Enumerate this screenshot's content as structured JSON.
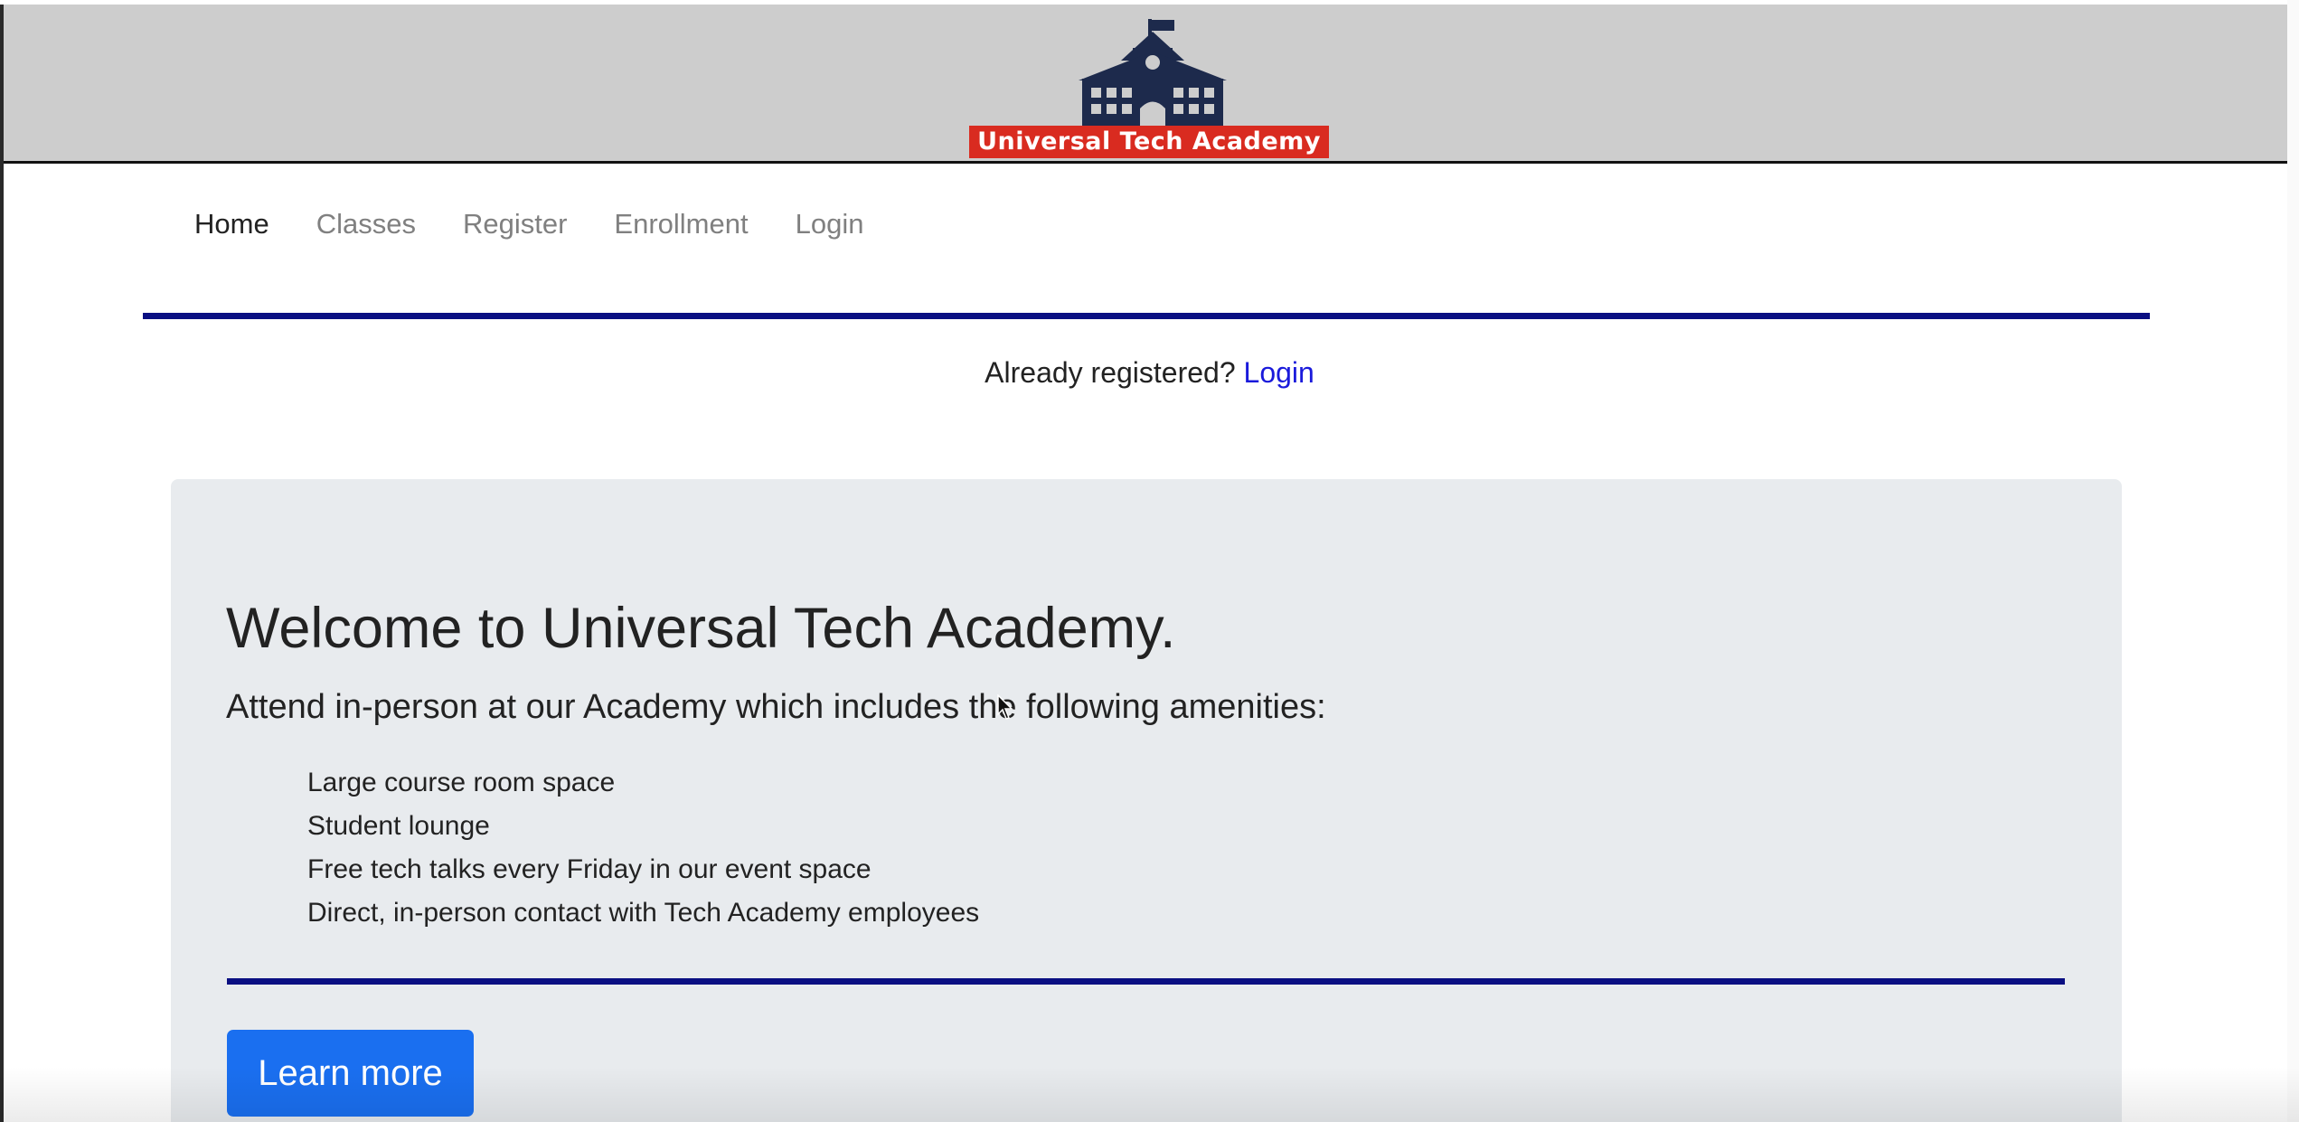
{
  "header": {
    "logo_text": "Universal Tech Academy",
    "brand_color": "#d92b20",
    "building_color": "#1d2a4c"
  },
  "nav": {
    "items": [
      {
        "label": "Home",
        "active": true
      },
      {
        "label": "Classes"
      },
      {
        "label": "Register"
      },
      {
        "label": "Enrollment"
      },
      {
        "label": "Login"
      }
    ],
    "rule_color": "#0a0f82"
  },
  "login_prompt": {
    "text": "Already registered?",
    "link": "Login"
  },
  "jumbotron": {
    "title": "Welcome to Universal Tech Academy.",
    "lead": "Attend in-person at our Academy which includes the following amenities:",
    "amenities": [
      "Large course room space",
      "Student lounge",
      "Free tech talks every Friday in our event space",
      "Direct, in-person contact with Tech Academy employees"
    ],
    "button": "Learn more",
    "button_color": "#1a6ff0"
  }
}
